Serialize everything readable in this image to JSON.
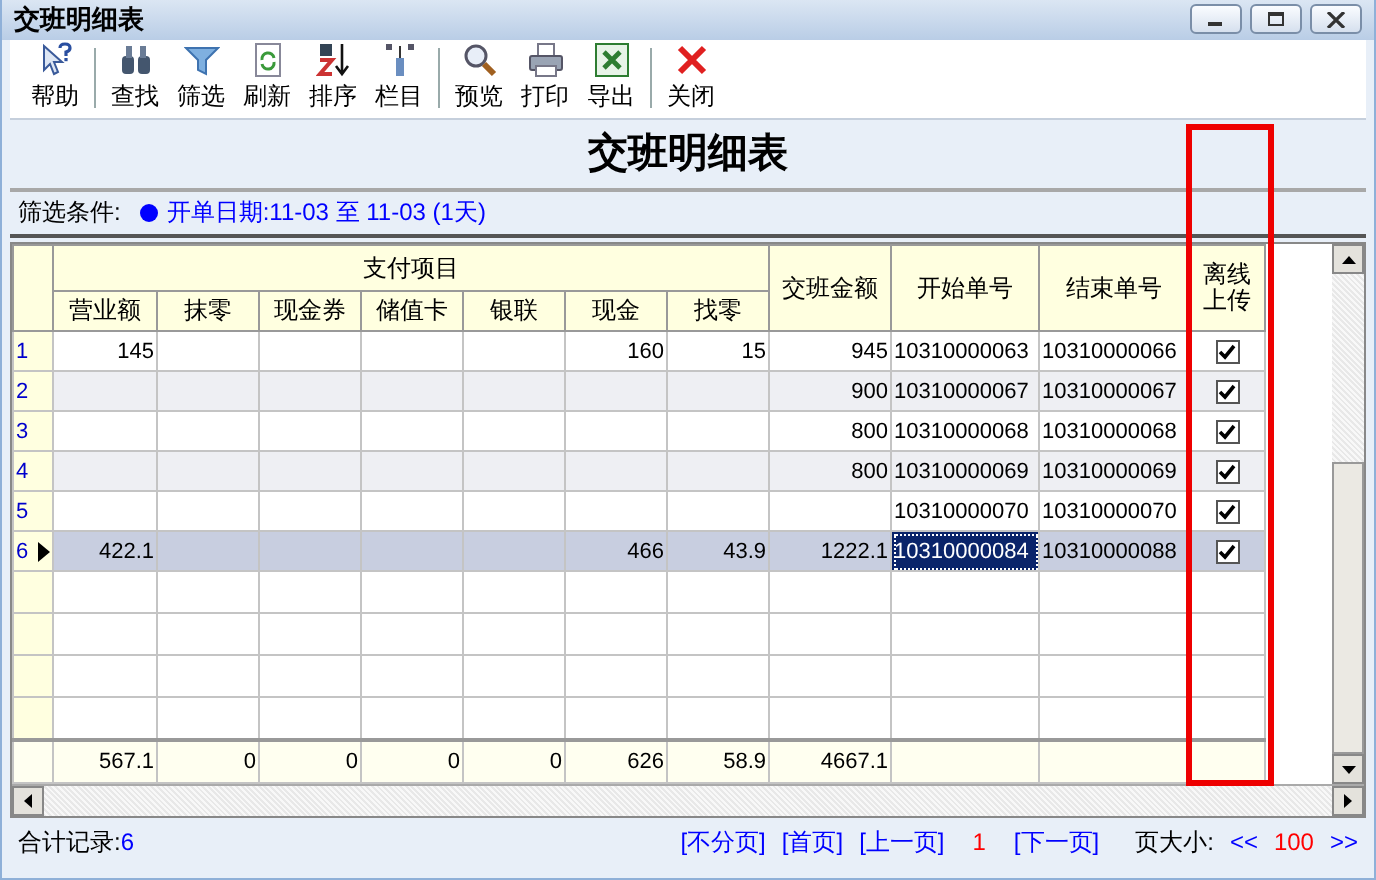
{
  "window": {
    "title": "交班明细表"
  },
  "toolbar": [
    {
      "kind": "help",
      "label": "帮助"
    },
    {
      "kind": "separator"
    },
    {
      "kind": "find",
      "label": "查找"
    },
    {
      "kind": "filter",
      "label": "筛选"
    },
    {
      "kind": "refresh",
      "label": "刷新"
    },
    {
      "kind": "sort",
      "label": "排序"
    },
    {
      "kind": "columns",
      "label": "栏目"
    },
    {
      "kind": "separator"
    },
    {
      "kind": "preview",
      "label": "预览"
    },
    {
      "kind": "print",
      "label": "打印"
    },
    {
      "kind": "export",
      "label": "导出"
    },
    {
      "kind": "separator"
    },
    {
      "kind": "close",
      "label": "关闭"
    }
  ],
  "report_title": "交班明细表",
  "filter": {
    "label": "筛选条件:",
    "value": "开单日期:11-03 至 11-03 (1天)"
  },
  "table": {
    "group_header": "支付项目",
    "amount_columns": [
      "营业额",
      "抹零",
      "现金券",
      "储值卡",
      "银联",
      "现金",
      "找零"
    ],
    "columns": [
      {
        "label": "交班金额",
        "highlighted": false
      },
      {
        "label": "开始单号",
        "highlighted": false
      },
      {
        "label": "结束单号",
        "highlighted": false
      },
      {
        "label": "离线上传",
        "highlighted": true
      }
    ],
    "rows": [
      {
        "number": "1",
        "selected": false,
        "revenue": "145",
        "cash": "160",
        "change": "15",
        "handover": "945",
        "start_no": "10310000063",
        "end_no": "10310000066",
        "start_focused": false,
        "uploaded": true
      },
      {
        "number": "2",
        "selected": false,
        "handover": "900",
        "start_no": "10310000067",
        "end_no": "10310000067",
        "start_focused": false,
        "uploaded": true
      },
      {
        "number": "3",
        "selected": false,
        "handover": "800",
        "start_no": "10310000068",
        "end_no": "10310000068",
        "start_focused": false,
        "uploaded": true
      },
      {
        "number": "4",
        "selected": false,
        "handover": "800",
        "start_no": "10310000069",
        "end_no": "10310000069",
        "start_focused": false,
        "uploaded": true
      },
      {
        "number": "5",
        "selected": false,
        "start_no": "10310000070",
        "end_no": "10310000070",
        "start_focused": false,
        "uploaded": true
      },
      {
        "number": "6",
        "selected": true,
        "revenue": "422.1",
        "cash": "466",
        "change": "43.9",
        "handover": "1222.1",
        "start_no": "10310000084",
        "end_no": "10310000088",
        "start_focused": true,
        "uploaded": true
      }
    ],
    "totals": [
      "567.1",
      "0",
      "0",
      "0",
      "0",
      "626",
      "58.9",
      "4667.1"
    ]
  },
  "status_bar": {
    "record_label": "合计记录:",
    "record_count": "6",
    "links": [
      "[不分页]",
      "[首页]",
      "[上一页]"
    ],
    "page": "1",
    "next_link": "[下一页]",
    "page_size_label": "页大小:",
    "prev_size": "<<",
    "page_size": "100",
    "next_size": ">>"
  }
}
